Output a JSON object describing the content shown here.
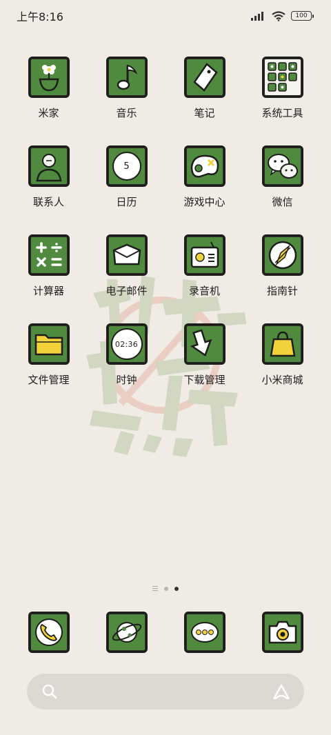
{
  "status_bar": {
    "time": "上午8:16",
    "battery": "100"
  },
  "apps": [
    {
      "label": "米家",
      "icon": "flower-pot-icon"
    },
    {
      "label": "音乐",
      "icon": "music-note-icon"
    },
    {
      "label": "笔记",
      "icon": "note-tag-icon"
    },
    {
      "label": "系统工具",
      "icon": "tools-folder-icon"
    },
    {
      "label": "联系人",
      "icon": "contact-person-icon"
    },
    {
      "label": "日历",
      "icon": "calendar-icon",
      "badge": "5"
    },
    {
      "label": "游戏中心",
      "icon": "gamepad-icon"
    },
    {
      "label": "微信",
      "icon": "wechat-icon"
    },
    {
      "label": "计算器",
      "icon": "calculator-icon"
    },
    {
      "label": "电子邮件",
      "icon": "envelope-icon"
    },
    {
      "label": "录音机",
      "icon": "recorder-icon"
    },
    {
      "label": "指南针",
      "icon": "compass-icon"
    },
    {
      "label": "文件管理",
      "icon": "folder-icon"
    },
    {
      "label": "时钟",
      "icon": "clock-icon",
      "badge": "02:36"
    },
    {
      "label": "下载管理",
      "icon": "download-arrow-icon"
    },
    {
      "label": "小米商城",
      "icon": "shopping-bag-icon"
    }
  ],
  "dock": [
    {
      "icon": "phone-icon"
    },
    {
      "icon": "browser-planet-icon"
    },
    {
      "icon": "messages-icon"
    },
    {
      "icon": "camera-icon"
    }
  ],
  "page_indicator": {
    "pages": 2,
    "active": 2
  },
  "colors": {
    "background": "#f0ebe5",
    "icon_green": "#4f8a3e",
    "icon_border": "#1d1d1b",
    "accent_yellow": "#f2d23a",
    "search_bar": "#ddd8d1"
  }
}
